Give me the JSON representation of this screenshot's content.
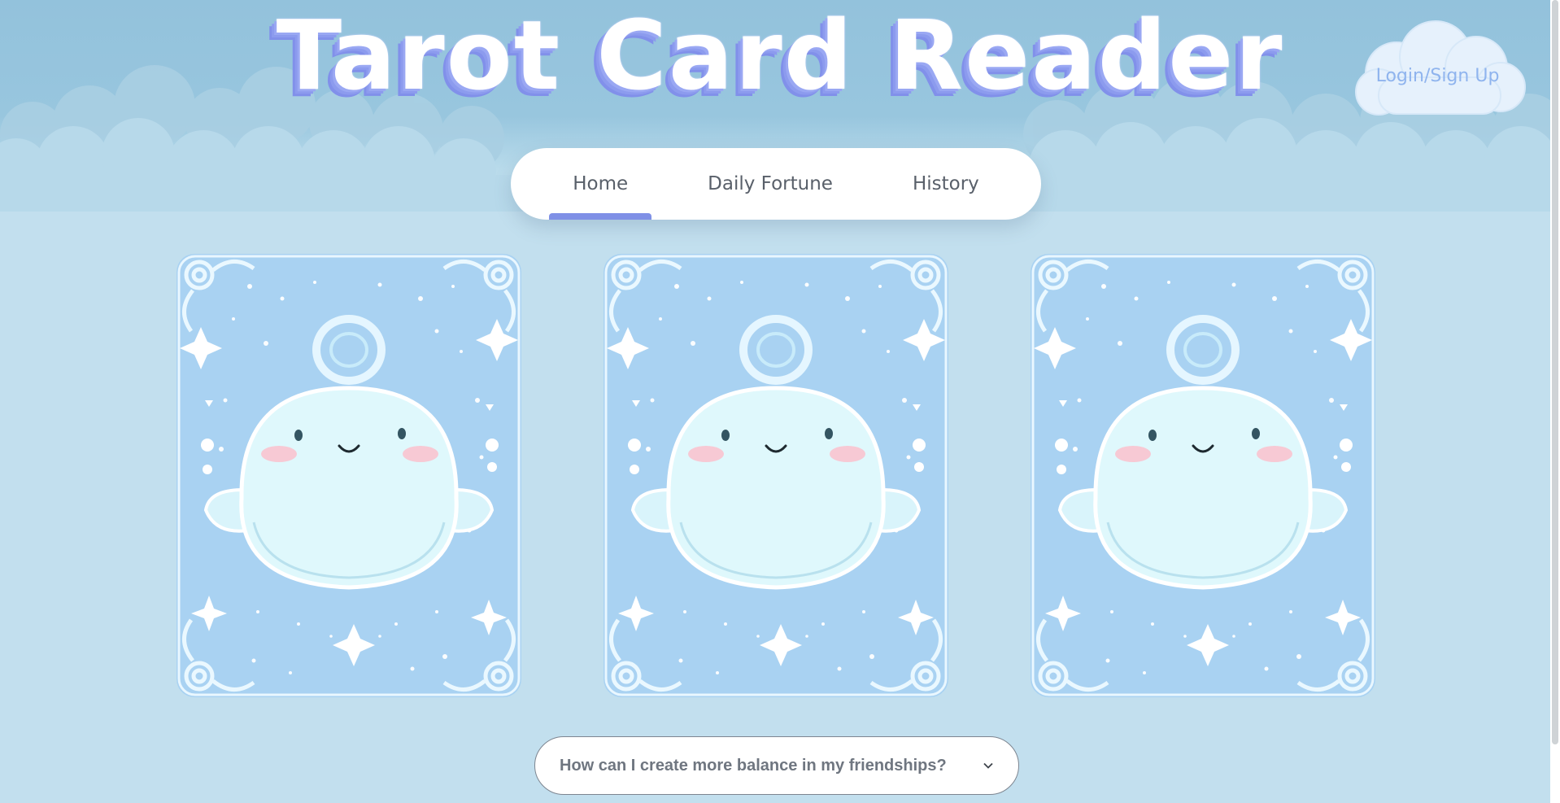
{
  "header": {
    "title": "Tarot Card Reader",
    "login_label": "Login/Sign Up"
  },
  "nav": {
    "tabs": [
      {
        "label": "Home",
        "active": true
      },
      {
        "label": "Daily Fortune",
        "active": false
      },
      {
        "label": "History",
        "active": false
      }
    ]
  },
  "cards": [
    {
      "icon": "ghost-card-back"
    },
    {
      "icon": "ghost-card-back"
    },
    {
      "icon": "ghost-card-back"
    }
  ],
  "question_select": {
    "selected": "How can I create more balance in my friendships?",
    "icon": "chevron-down-icon"
  },
  "colors": {
    "sky": "#93c2dc",
    "background": "#c2dfee",
    "accent": "#7f90e6",
    "card": "#a9d2f2"
  }
}
